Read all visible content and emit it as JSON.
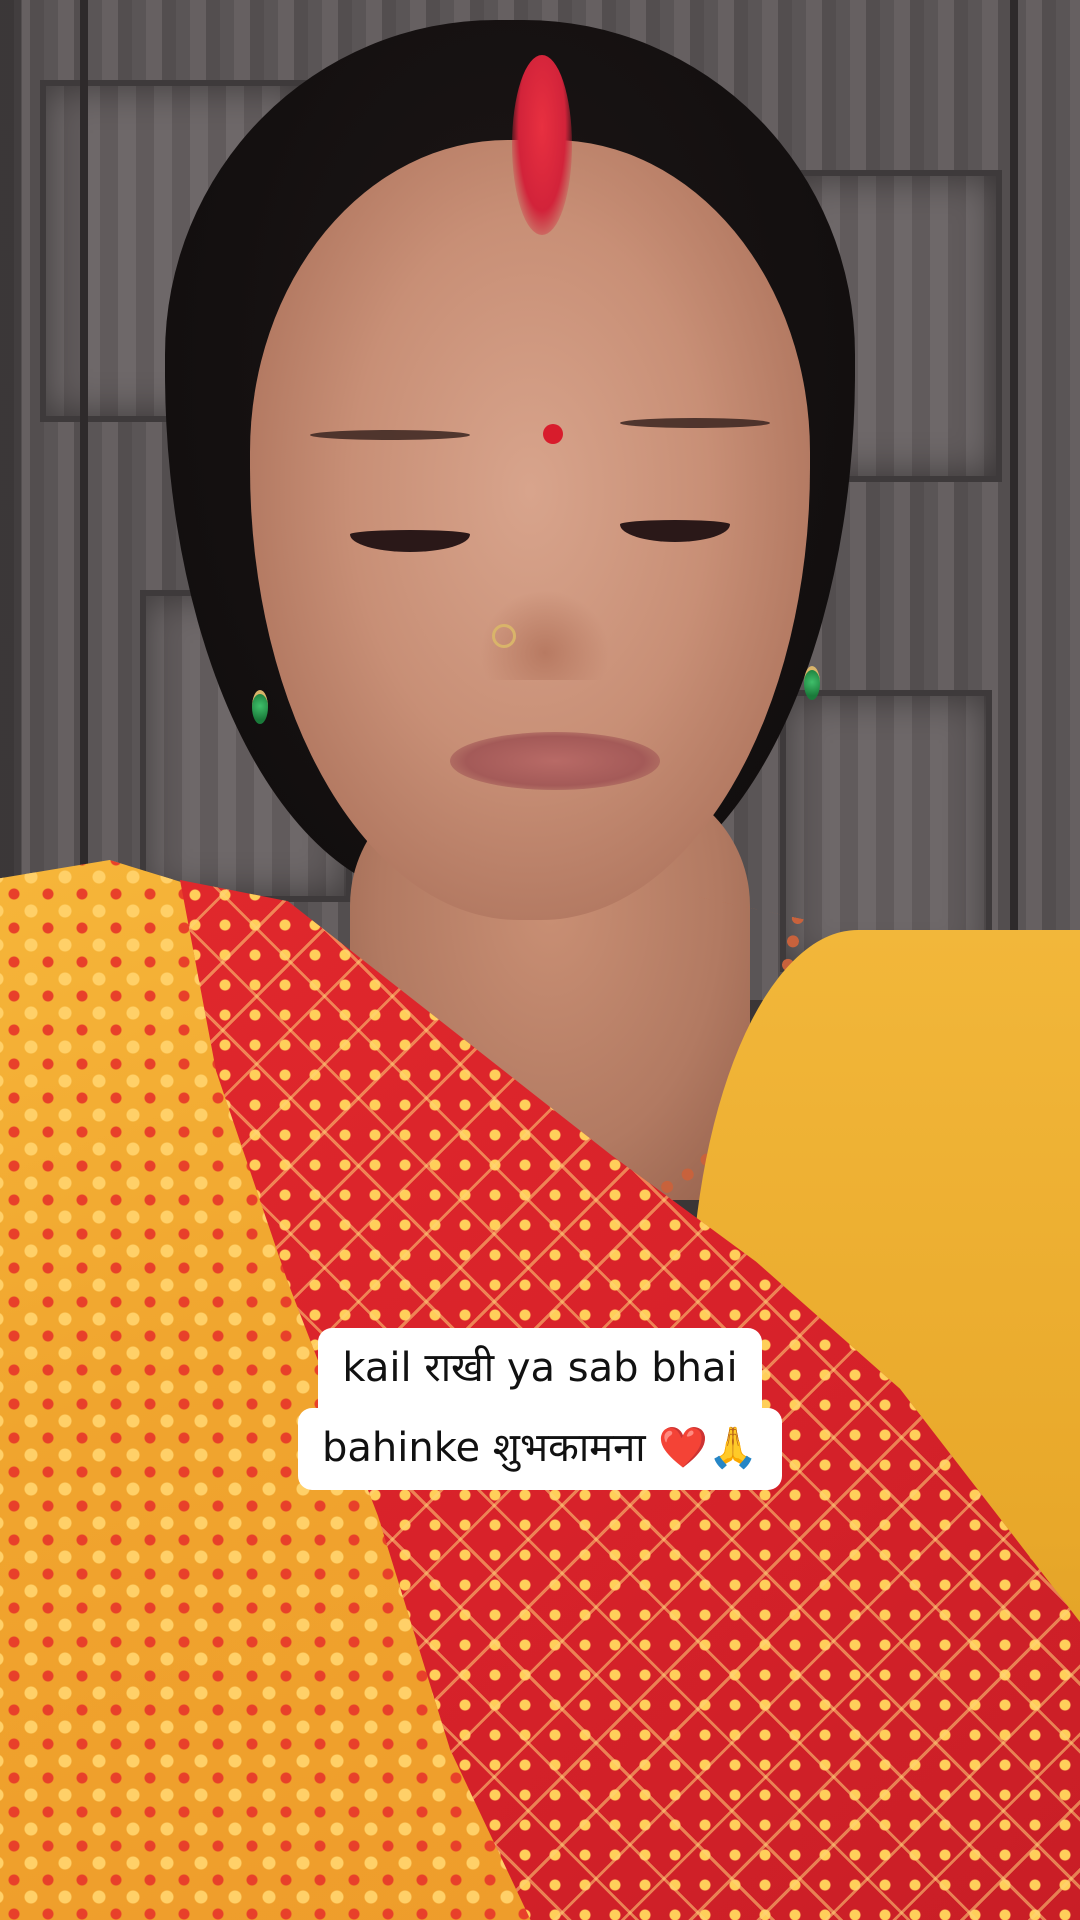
{
  "video": {
    "caption_line_1": "kail राखी ya sab bhai",
    "caption_line_2": "bahinke शुभकामना ❤️🙏"
  },
  "colors": {
    "caption_background": "#ffffff",
    "caption_text": "#111111",
    "dupatta_yellow": "#f0a52e",
    "dupatta_red": "#d8222a",
    "blouse": "#e8a82a",
    "sindoor": "#d2233a"
  }
}
